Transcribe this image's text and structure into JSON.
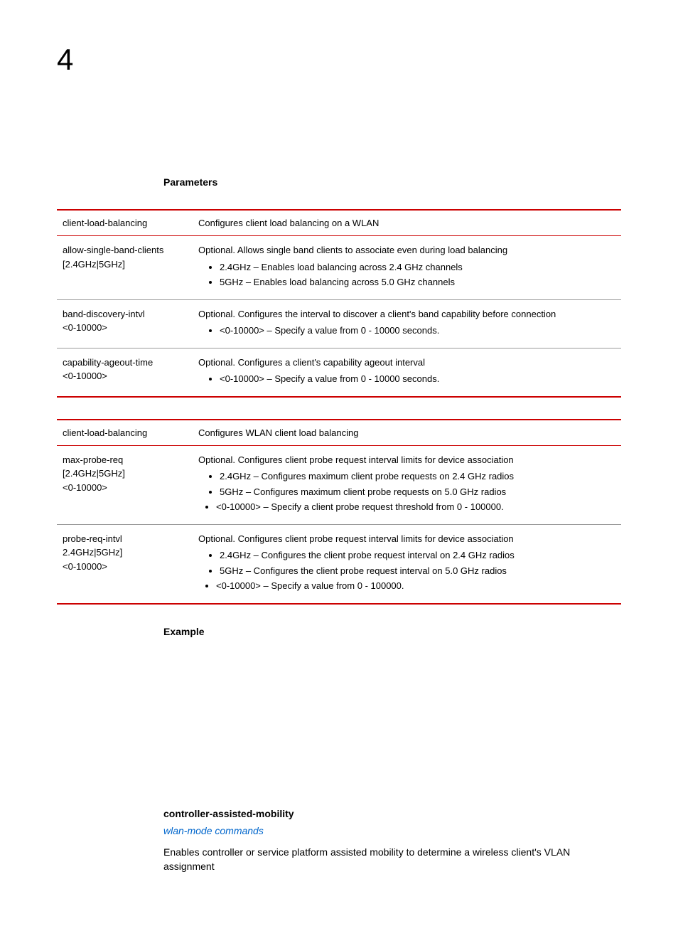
{
  "chapter_number": "4",
  "parameters_heading": "Parameters",
  "table1": {
    "header": {
      "col1": "client-load-balancing",
      "col2": "Configures client load balancing on a WLAN"
    },
    "rows": [
      {
        "name_lines": [
          "allow-single-band-clients",
          "[2.4GHz|5GHz]"
        ],
        "desc": "Optional. Allows single band clients to associate even during load balancing",
        "bullets": [
          "2.4GHz – Enables load balancing across 2.4 GHz channels",
          "5GHz – Enables load balancing across 5.0 GHz channels"
        ]
      },
      {
        "name_lines": [
          "band-discovery-intvl",
          "<0-10000>"
        ],
        "desc": "Optional. Configures the interval to discover a client's band capability before connection",
        "bullets": [
          "<0-10000> – Specify a value from 0 - 10000 seconds."
        ]
      },
      {
        "name_lines": [
          "capability-ageout-time",
          "<0-10000>"
        ],
        "desc": "Optional. Configures a client's capability ageout interval",
        "bullets": [
          "<0-10000> – Specify a value from 0 - 10000 seconds."
        ]
      }
    ]
  },
  "table2": {
    "header": {
      "col1": "client-load-balancing",
      "col2": "Configures WLAN client load balancing"
    },
    "rows": [
      {
        "name_lines": [
          "max-probe-req",
          "[2.4GHz|5GHz]",
          "<0-10000>"
        ],
        "desc": "Optional. Configures client probe request interval limits for device association",
        "bullets": [
          "2.4GHz – Configures maximum client probe requests on 2.4 GHz radios",
          "5GHz – Configures maximum client probe requests on 5.0 GHz radios"
        ],
        "nested": "<0-10000> – Specify a client probe request threshold from 0 - 100000."
      },
      {
        "name_lines": [
          "probe-req-intvl",
          "2.4GHz|5GHz]",
          "<0-10000>"
        ],
        "desc": "Optional. Configures client probe request interval limits for device association",
        "bullets": [
          "2.4GHz – Configures the client probe request interval on 2.4 GHz radios",
          "5GHz – Configures the client probe request interval on 5.0 GHz radios"
        ],
        "nested": "<0-10000> – Specify a value from 0 - 100000."
      }
    ]
  },
  "example_heading": "Example",
  "command_title": "controller-assisted-mobility",
  "link_text": "wlan-mode commands",
  "body_text": "Enables controller or service platform assisted mobility to determine a wireless client's VLAN assignment"
}
